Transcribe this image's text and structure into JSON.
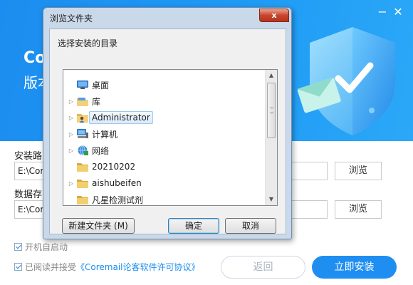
{
  "installer": {
    "app_title": "Core",
    "version_label": "版本",
    "install_path_label": "安装路",
    "install_path_value": "E:\\Corem",
    "data_path_label": "数据存",
    "data_path_value": "E:\\Corem",
    "browse_label": "浏览",
    "autostart_label": "开机自启动",
    "agree_prefix": "已阅读并接受",
    "agree_link": "《Coremail论客软件许可协议》",
    "back_label": "返回",
    "install_label": "立即安装",
    "minimize_glyph": "−",
    "close_glyph": "✕",
    "colors": {
      "primary": "#1f8ef1",
      "hero": "#1e9af5"
    }
  },
  "dialog": {
    "title": "浏览文件夹",
    "close_glyph": "x",
    "prompt": "选择安装的目录",
    "tree": [
      {
        "label": "桌面",
        "icon": "desktop-icon",
        "expandable": false,
        "selected": false
      },
      {
        "label": "库",
        "icon": "library-icon",
        "expandable": true,
        "selected": false
      },
      {
        "label": "Administrator",
        "icon": "user-folder-icon",
        "expandable": true,
        "selected": true
      },
      {
        "label": "计算机",
        "icon": "computer-icon",
        "expandable": true,
        "selected": false
      },
      {
        "label": "网络",
        "icon": "network-icon",
        "expandable": true,
        "selected": false
      },
      {
        "label": "20210202",
        "icon": "folder-icon",
        "expandable": false,
        "selected": false
      },
      {
        "label": "aishubeifen",
        "icon": "folder-icon",
        "expandable": true,
        "selected": false
      },
      {
        "label": "凡星检测试剂",
        "icon": "folder-icon",
        "expandable": false,
        "selected": false
      }
    ],
    "new_folder_label": "新建文件夹 (M)",
    "ok_label": "确定",
    "cancel_label": "取消"
  }
}
